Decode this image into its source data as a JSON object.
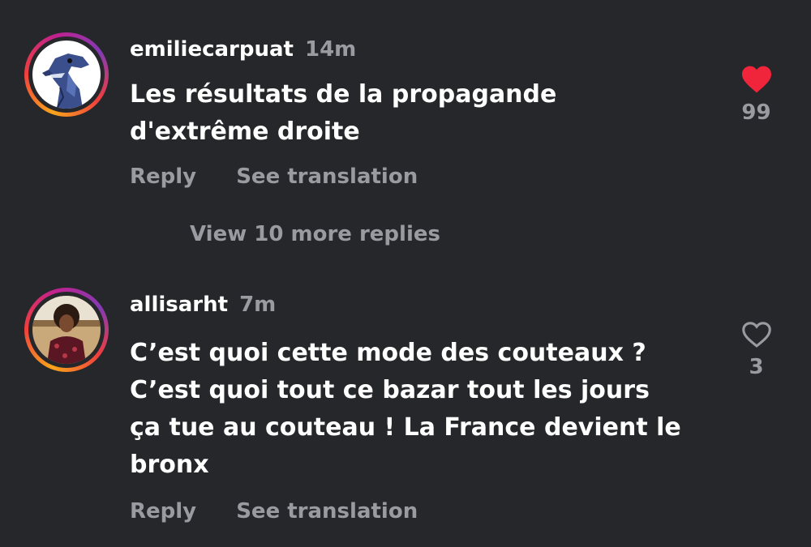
{
  "comments": [
    {
      "username": "emiliecarpuat",
      "time": "14m",
      "text_lines": [
        "Les résultats de la propagande",
        "d'extrême droite"
      ],
      "reply": "Reply",
      "translate": "See translation",
      "likes": "99",
      "liked": true,
      "like_color": "#f0243b",
      "avatar": "raptor-avatar"
    },
    {
      "username": "allisarht",
      "time": "7m",
      "text_lines": [
        "C’est quoi cette mode des couteaux ?",
        "C’est quoi tout ce bazar tout les jours",
        "ça tue au couteau ! La France devient le",
        "bronx"
      ],
      "reply": "Reply",
      "translate": "See translation",
      "likes": "3",
      "liked": false,
      "avatar": "person-avatar"
    }
  ],
  "view_more": "View 10 more replies"
}
